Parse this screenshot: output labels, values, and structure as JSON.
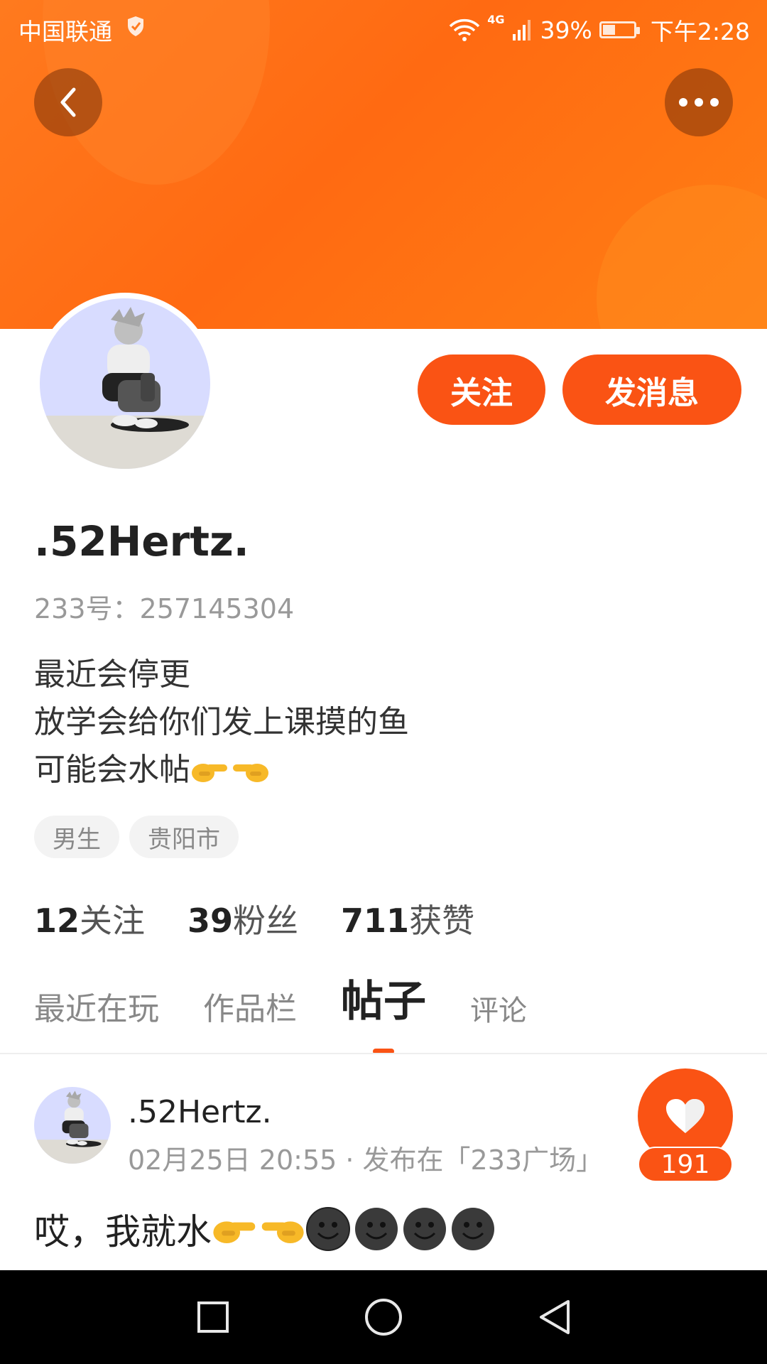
{
  "status_bar": {
    "carrier": "中国联通",
    "network": "4G",
    "battery": "39%",
    "time": "下午2:28"
  },
  "header": {
    "back_icon": "chevron-left-icon",
    "more_icon": "more-horizontal-icon"
  },
  "profile": {
    "follow_label": "关注",
    "message_label": "发消息",
    "username": ".52Hertz.",
    "id_text": "233号：257145304",
    "bio_lines": [
      "最近会停更",
      "放学会给你们发上课摸的鱼",
      "可能会水帖"
    ],
    "tags": [
      "男生",
      "贵阳市"
    ],
    "stats": [
      {
        "num": "12",
        "label": "关注"
      },
      {
        "num": "39",
        "label": "粉丝"
      },
      {
        "num": "711",
        "label": "获赞"
      }
    ]
  },
  "tabs": [
    "最近在玩",
    "作品栏",
    "帖子",
    "评论"
  ],
  "active_tab": "帖子",
  "post": {
    "author": ".52Hertz.",
    "meta": "02月25日 20:55 · 发布在「233广场」",
    "like_count": "191",
    "text": "哎，我就水"
  },
  "colors": {
    "accent": "#fa5314",
    "banner": "#ff7a1e"
  }
}
